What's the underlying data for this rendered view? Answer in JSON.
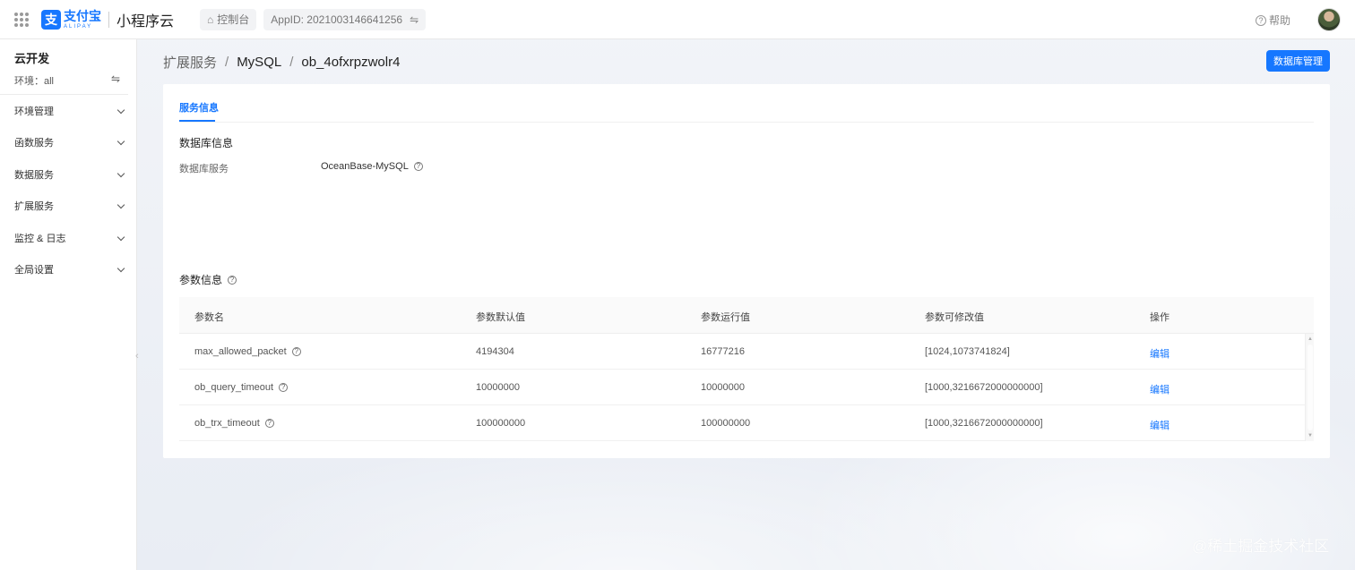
{
  "topbar": {
    "brand_cn": "支付宝",
    "brand_en": "ALIPAY",
    "product": "小程序云",
    "console_label": "控制台",
    "appid": "AppID: 2021003146641256",
    "help": "帮助"
  },
  "sidebar": {
    "title": "云开发",
    "env": "环境：all",
    "items": [
      {
        "label": "环境管理"
      },
      {
        "label": "函数服务"
      },
      {
        "label": "数据服务"
      },
      {
        "label": "扩展服务"
      },
      {
        "label": "监控 & 日志"
      },
      {
        "label": "全局设置"
      }
    ]
  },
  "breadcrumb": [
    "扩展服务",
    "MySQL",
    "ob_4ofxrpzwolr4"
  ],
  "db_manage_button": "数据库管理",
  "tab": "服务信息",
  "db_info": {
    "title": "数据库信息",
    "label": "数据库服务",
    "value": "OceanBase-MySQL"
  },
  "params": {
    "title": "参数信息",
    "columns": [
      "参数名",
      "参数默认值",
      "参数运行值",
      "参数可修改值",
      "操作"
    ],
    "rows": [
      {
        "name": "max_allowed_packet",
        "default": "4194304",
        "running": "16777216",
        "range": "[1024,1073741824]",
        "action": "编辑"
      },
      {
        "name": "ob_query_timeout",
        "default": "10000000",
        "running": "10000000",
        "range": "[1000,3216672000000000]",
        "action": "编辑"
      },
      {
        "name": "ob_trx_timeout",
        "default": "100000000",
        "running": "100000000",
        "range": "[1000,3216672000000000]",
        "action": "编辑"
      }
    ]
  },
  "watermark": "@稀土掘金技术社区"
}
